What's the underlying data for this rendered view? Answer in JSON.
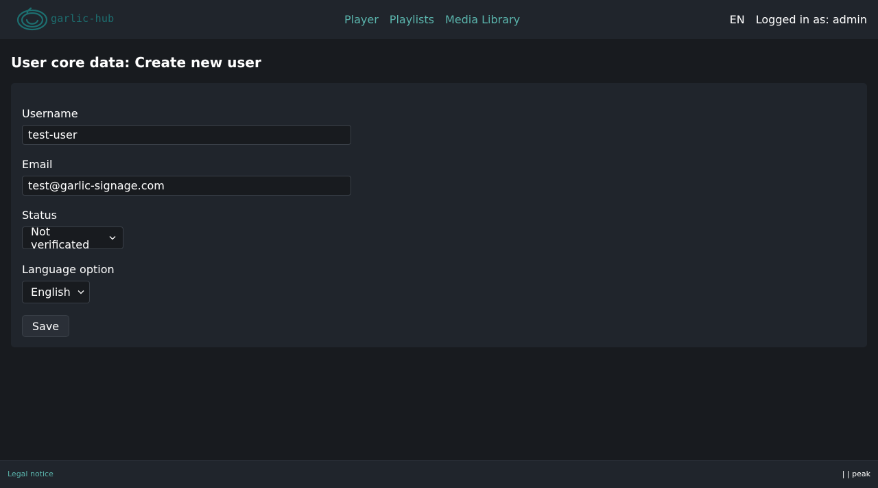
{
  "header": {
    "logo_text": "garlic-hub",
    "nav": [
      {
        "label": "Player"
      },
      {
        "label": "Playlists"
      },
      {
        "label": "Media Library"
      }
    ],
    "language": "EN",
    "user_label": "Logged in as: admin"
  },
  "page": {
    "title": "User core data: Create new user"
  },
  "form": {
    "username": {
      "label": "Username",
      "value": "test-user"
    },
    "email": {
      "label": "Email",
      "value": "test@garlic-signage.com"
    },
    "status": {
      "label": "Status",
      "selected": "Not verificated"
    },
    "language": {
      "label": "Language option",
      "selected": "English"
    },
    "save_label": "Save"
  },
  "footer": {
    "legal_label": "Legal notice",
    "right_text": "| | peak"
  },
  "colors": {
    "accent": "#5ab4ac",
    "background": "#181b1f",
    "panel": "#20252c"
  },
  "icons": {
    "logo": "garlic-logo-icon",
    "select_arrow": "chevron-down-icon"
  }
}
